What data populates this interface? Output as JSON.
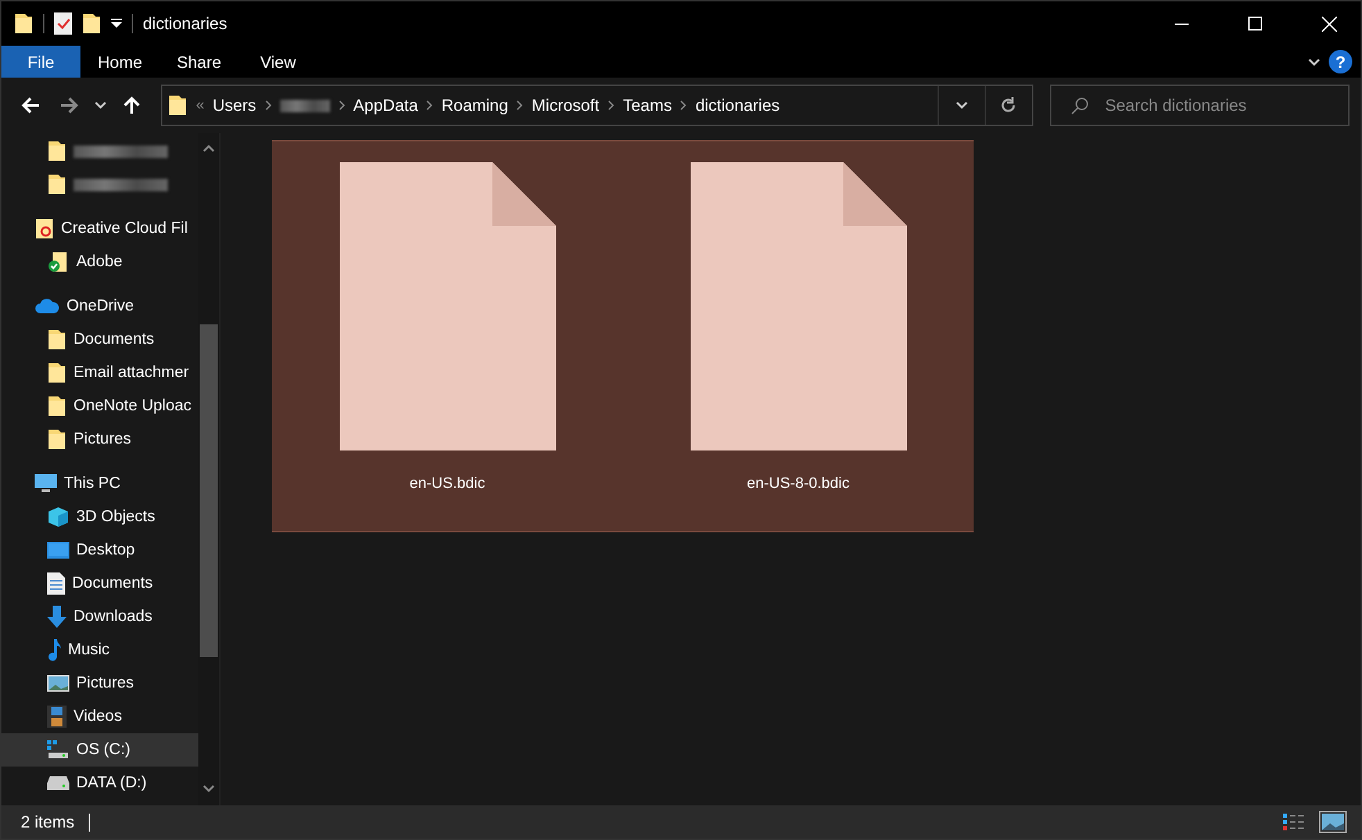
{
  "window": {
    "title": "dictionaries"
  },
  "ribbon": {
    "tabs": [
      {
        "label": "File",
        "selected": true
      },
      {
        "label": "Home",
        "selected": false
      },
      {
        "label": "Share",
        "selected": false
      },
      {
        "label": "View",
        "selected": false
      }
    ],
    "help": "?"
  },
  "address": {
    "overflow": "«",
    "crumbs": [
      {
        "label": "Users"
      },
      {
        "kind": "redacted"
      },
      {
        "label": "AppData"
      },
      {
        "label": "Roaming"
      },
      {
        "label": "Microsoft"
      },
      {
        "label": "Teams"
      },
      {
        "label": "dictionaries"
      }
    ]
  },
  "search": {
    "placeholder": "Search dictionaries"
  },
  "sidebar": [
    {
      "kind": "redacted",
      "selected": false
    },
    {
      "kind": "redacted",
      "selected": false
    },
    {
      "label": "Creative Cloud Fil",
      "selected": false,
      "children": [
        {
          "label": "Adobe",
          "selected": false
        }
      ]
    },
    {
      "label": "OneDrive",
      "selected": false,
      "children": [
        {
          "label": "Documents",
          "selected": false
        },
        {
          "label": "Email attachmer",
          "selected": false
        },
        {
          "label": "OneNote Uploac",
          "selected": false
        },
        {
          "label": "Pictures",
          "selected": false
        }
      ]
    },
    {
      "label": "This PC",
      "selected": false,
      "children": [
        {
          "label": "3D Objects",
          "selected": false
        },
        {
          "label": "Desktop",
          "selected": false
        },
        {
          "label": "Documents",
          "selected": false
        },
        {
          "label": "Downloads",
          "selected": false
        },
        {
          "label": "Music",
          "selected": false
        },
        {
          "label": "Pictures",
          "selected": false
        },
        {
          "label": "Videos",
          "selected": false
        },
        {
          "label": "OS (C:)",
          "selected": true
        },
        {
          "label": "DATA (D:)",
          "selected": false
        }
      ]
    }
  ],
  "files": [
    {
      "name": "en-US.bdic",
      "selected": true
    },
    {
      "name": "en-US-8-0.bdic",
      "selected": true
    }
  ],
  "status_bar": {
    "count": "2 items"
  }
}
